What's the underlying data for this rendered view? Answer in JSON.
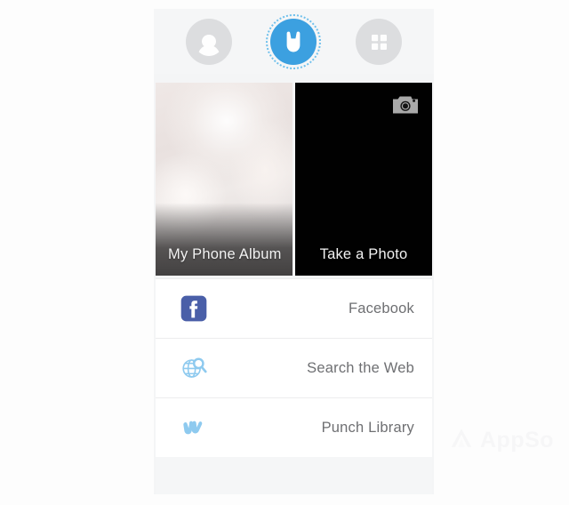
{
  "app": {
    "background_color": "#f4f5f6",
    "accent_color": "#3ca0e0",
    "icon_tint": "#8ecaef"
  },
  "top_bar": {
    "background_color": "#f5f6f7",
    "items": [
      {
        "id": "avatar-left",
        "icon": "person-silhouette-icon",
        "state": "inactive",
        "circle_color": "#dcdddf",
        "glyph_color": "#ffffff"
      },
      {
        "id": "avatar-center",
        "icon": "punch-mascot-icon",
        "state": "active",
        "circle_color": "#3ca0e0",
        "glyph_color": "#ffffff",
        "ring": "dotted-selection-ring"
      },
      {
        "id": "avatar-right",
        "icon": "grid-four-squares-icon",
        "state": "inactive",
        "circle_color": "#dcdddf",
        "glyph_color": "#ffffff"
      }
    ]
  },
  "tiles": [
    {
      "id": "my-phone-album",
      "label": "My Phone Album",
      "kind": "photo-thumbnail",
      "label_color": "#f2f2f2"
    },
    {
      "id": "take-a-photo",
      "label": "Take a Photo",
      "kind": "camera-capture",
      "background_color": "#010101",
      "icon": "camera-icon",
      "icon_color": "#a9a9a9",
      "label_color": "#f2f2f2"
    }
  ],
  "options": [
    {
      "id": "facebook",
      "label": "Facebook",
      "icon": "facebook-logo-icon",
      "icon_color": "#4a5fa8"
    },
    {
      "id": "search-the-web",
      "label": "Search the Web",
      "icon": "globe-search-icon",
      "icon_color": "#8ecaef"
    },
    {
      "id": "punch-library",
      "label": "Punch Library",
      "icon": "punch-flower-icon",
      "icon_color": "#8ecaef"
    }
  ],
  "watermark": {
    "text": "AppSo",
    "icon": "appso-triangle-logo-icon",
    "color": "#f0f1f2"
  }
}
